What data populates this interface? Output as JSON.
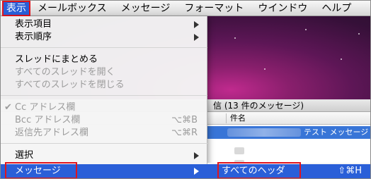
{
  "menubar": {
    "items": [
      {
        "label": "表示",
        "active": true
      },
      {
        "label": "メールボックス"
      },
      {
        "label": "メッセージ"
      },
      {
        "label": "フォーマット"
      },
      {
        "label": "ウインドウ"
      },
      {
        "label": "ヘルプ"
      }
    ]
  },
  "view_menu": {
    "items": [
      {
        "label": "表示項目",
        "submenu": true
      },
      {
        "label": "表示順序",
        "submenu": true
      },
      {
        "label": "スレッドにまとめる"
      },
      {
        "label": "すべてのスレッドを開く",
        "disabled": true
      },
      {
        "label": "すべてのスレッドを閉じる",
        "disabled": true
      },
      {
        "label": "Cc アドレス欄",
        "disabled": true,
        "checked": true,
        "check": "✔"
      },
      {
        "label": "Bcc アドレス欄",
        "disabled": true,
        "shortcut": "⌥⌘B"
      },
      {
        "label": "返信先アドレス欄",
        "disabled": true,
        "shortcut": "⌥⌘R"
      },
      {
        "label": "選択",
        "submenu": true
      },
      {
        "label": "メッセージ",
        "submenu": true,
        "highlighted": true
      }
    ]
  },
  "message_submenu": {
    "items": [
      {
        "label": "すべてのヘッダ",
        "shortcut": "⇧⌘H",
        "highlighted": true
      }
    ]
  },
  "background_window": {
    "list_title": "信 (13 件のメッセージ)",
    "column_header": "件名",
    "selected_row_subject": "テスト メッセージ"
  },
  "colors": {
    "highlight": "#2a5fd8",
    "annotation_box": "#e0141e"
  }
}
